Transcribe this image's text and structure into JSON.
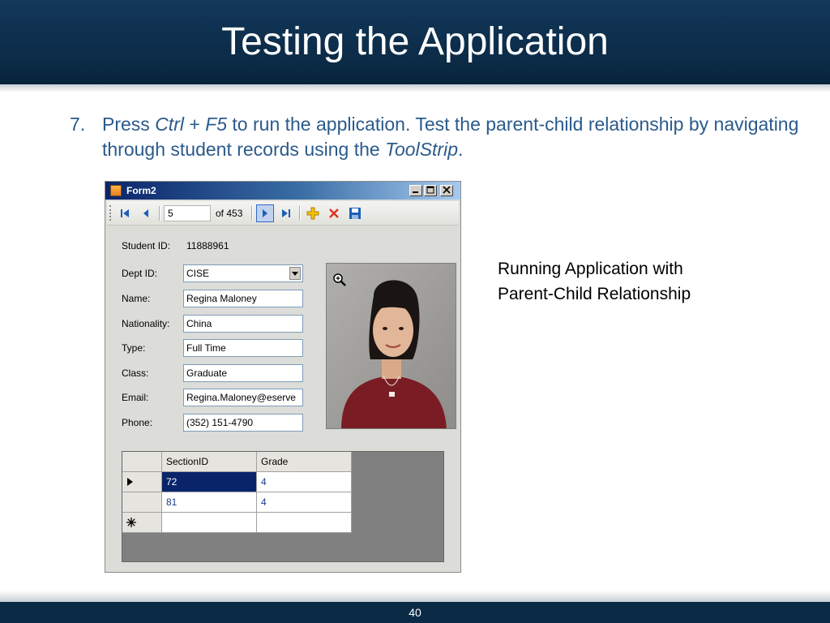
{
  "slide": {
    "title": "Testing the Application",
    "step_number": "7.",
    "step_parts": [
      "Press ",
      "Ctrl",
      " + ",
      "F5",
      " to run the application. Test the parent-child relationship by navigating through student records using the ",
      "ToolStrip",
      "."
    ],
    "caption_line1": "Running Application with",
    "caption_line2": "Parent-Child Relationship",
    "page_number": "40"
  },
  "window": {
    "title": "Form2",
    "toolstrip": {
      "position_value": "5",
      "count_label": "of 453"
    },
    "fields": {
      "student_id_label": "Student ID:",
      "student_id_value": "11888961",
      "dept_label": "Dept ID:",
      "dept_value": "CISE",
      "name_label": "Name:",
      "name_value": "Regina  Maloney",
      "nationality_label": "Nationality:",
      "nationality_value": "China",
      "type_label": "Type:",
      "type_value": "Full Time",
      "class_label": "Class:",
      "class_value": "Graduate",
      "email_label": "Email:",
      "email_value": "Regina.Maloney@eserve",
      "phone_label": "Phone:",
      "phone_value": "(352) 151-4790"
    },
    "grid": {
      "columns": [
        "SectionID",
        "Grade"
      ],
      "rows": [
        {
          "section_id": "72",
          "grade": "4",
          "selected": true
        },
        {
          "section_id": "81",
          "grade": "4",
          "selected": false
        }
      ]
    }
  },
  "colors": {
    "header_bg": "#0b2b47",
    "step_text": "#2a5a8c",
    "selection": "#0a246a"
  }
}
